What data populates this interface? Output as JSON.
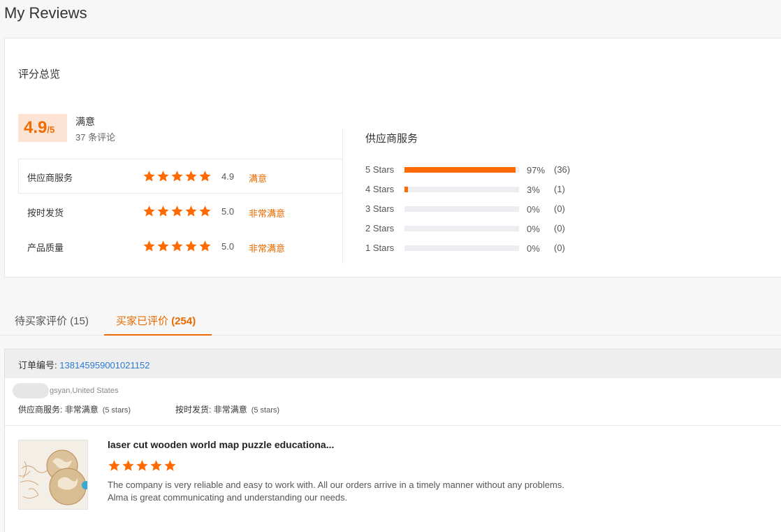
{
  "page": {
    "title": "My Reviews"
  },
  "overview": {
    "title": "评分总览",
    "score": "4.9",
    "score_suffix": "/5",
    "satisfaction": "满意",
    "review_count": "37 条评论",
    "rows": [
      {
        "label": "供应商服务",
        "stars": 5,
        "score": "4.9",
        "satisfaction": "满意"
      },
      {
        "label": "按时发货",
        "stars": 5,
        "score": "5.0",
        "satisfaction": "非常满意"
      },
      {
        "label": "产品质量",
        "stars": 5,
        "score": "5.0",
        "satisfaction": "非常满意"
      }
    ]
  },
  "distribution": {
    "title": "供应商服务",
    "rows": [
      {
        "label": "5 Stars",
        "percent": 97,
        "percent_text": "97%",
        "count": "(36)"
      },
      {
        "label": "4 Stars",
        "percent": 3,
        "percent_text": "3%",
        "count": "(1)"
      },
      {
        "label": "3 Stars",
        "percent": 0,
        "percent_text": "0%",
        "count": "(0)"
      },
      {
        "label": "2 Stars",
        "percent": 0,
        "percent_text": "0%",
        "count": "(0)"
      },
      {
        "label": "1 Stars",
        "percent": 0,
        "percent_text": "0%",
        "count": "(0)"
      }
    ]
  },
  "tabs": [
    {
      "label": "待买家评价",
      "count": "(15)",
      "active": false
    },
    {
      "label": "买家已评价",
      "count": "(254)",
      "active": true
    }
  ],
  "order": {
    "label": "订单编号:",
    "number": "138145959001021152",
    "buyer": "gsyan,United States",
    "supplier_service": {
      "label": "供应商服务:",
      "value": "非常满意",
      "stars_text": "(5 stars)"
    },
    "delivery": {
      "label": "按时发货:",
      "value": "非常满意",
      "stars_text": "(5 stars)"
    },
    "product": {
      "title": "laser cut wooden world map puzzle educationa...",
      "stars": 5,
      "review": "The company is very reliable and easy to work with. All our orders arrive in a timely manner without any problems. Alma is great communicating and understanding our needs."
    }
  },
  "colors": {
    "accent": "#ff6a00",
    "link": "#2a7bd6",
    "star": "#ff6a00"
  }
}
